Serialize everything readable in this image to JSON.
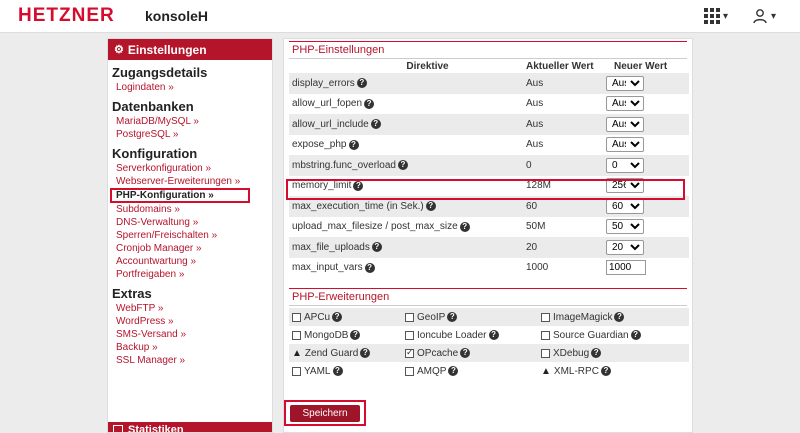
{
  "header": {
    "logo": "HETZNER",
    "product": "konsoleH"
  },
  "sidebar": {
    "heading": "Einstellungen",
    "sections": [
      {
        "title": "Zugangsdetails",
        "items": [
          "Logindaten »"
        ]
      },
      {
        "title": "Datenbanken",
        "items": [
          "MariaDB/MySQL »",
          "PostgreSQL »"
        ]
      },
      {
        "title": "Konfiguration",
        "items": [
          "Serverkonfiguration »",
          "Webserver-Erweiterungen »",
          "PHP-Konfiguration »",
          "Subdomains »",
          "DNS-Verwaltung »",
          "Sperren/Freischalten »",
          "Cronjob Manager »",
          "Accountwartung »",
          "Portfreigaben »"
        ]
      },
      {
        "title": "Extras",
        "items": [
          "WebFTP »",
          "WordPress »",
          "SMS-Versand »",
          "Backup »",
          "SSL Manager »"
        ]
      }
    ],
    "active_item": "PHP-Konfiguration »",
    "footer": "Statistiken"
  },
  "php_settings": {
    "title": "PHP-Einstellungen",
    "columns": [
      "Direktive",
      "Aktueller Wert",
      "Neuer Wert"
    ],
    "rows": [
      {
        "directive": "display_errors",
        "current": "Aus",
        "new": "Aus",
        "type": "select"
      },
      {
        "directive": "allow_url_fopen",
        "current": "Aus",
        "new": "Aus",
        "type": "select"
      },
      {
        "directive": "allow_url_include",
        "current": "Aus",
        "new": "Aus",
        "type": "select"
      },
      {
        "directive": "expose_php",
        "current": "Aus",
        "new": "Aus",
        "type": "select"
      },
      {
        "directive": "mbstring.func_overload",
        "current": "0",
        "new": "0",
        "type": "select"
      },
      {
        "directive": "memory_limit",
        "current": "128M",
        "new": "256",
        "type": "select"
      },
      {
        "directive": "max_execution_time (in Sek.)",
        "current": "60",
        "new": "60",
        "type": "select"
      },
      {
        "directive": "upload_max_filesize / post_max_size",
        "current": "50M",
        "new": "50",
        "type": "select"
      },
      {
        "directive": "max_file_uploads",
        "current": "20",
        "new": "20",
        "type": "select"
      },
      {
        "directive": "max_input_vars",
        "current": "1000",
        "new": "1000",
        "type": "input"
      }
    ]
  },
  "php_extensions": {
    "title": "PHP-Erweiterungen",
    "rows": [
      [
        {
          "label": "APCu",
          "mark": "checkbox",
          "checked": false
        },
        {
          "label": "GeoIP",
          "mark": "checkbox",
          "checked": false
        },
        {
          "label": "ImageMagick",
          "mark": "checkbox",
          "checked": false
        }
      ],
      [
        {
          "label": "MongoDB",
          "mark": "checkbox",
          "checked": false
        },
        {
          "label": "Ioncube Loader",
          "mark": "checkbox",
          "checked": false
        },
        {
          "label": "Source Guardian",
          "mark": "checkbox",
          "checked": false
        }
      ],
      [
        {
          "label": "Zend Guard",
          "mark": "warning",
          "checked": false
        },
        {
          "label": "OPcache",
          "mark": "checkbox",
          "checked": true
        },
        {
          "label": "XDebug",
          "mark": "checkbox",
          "checked": false
        }
      ],
      [
        {
          "label": "YAML",
          "mark": "checkbox",
          "checked": false
        },
        {
          "label": "AMQP",
          "mark": "checkbox",
          "checked": false
        },
        {
          "label": "XML-RPC",
          "mark": "warning",
          "checked": false
        }
      ]
    ]
  },
  "save_label": "Speichern"
}
